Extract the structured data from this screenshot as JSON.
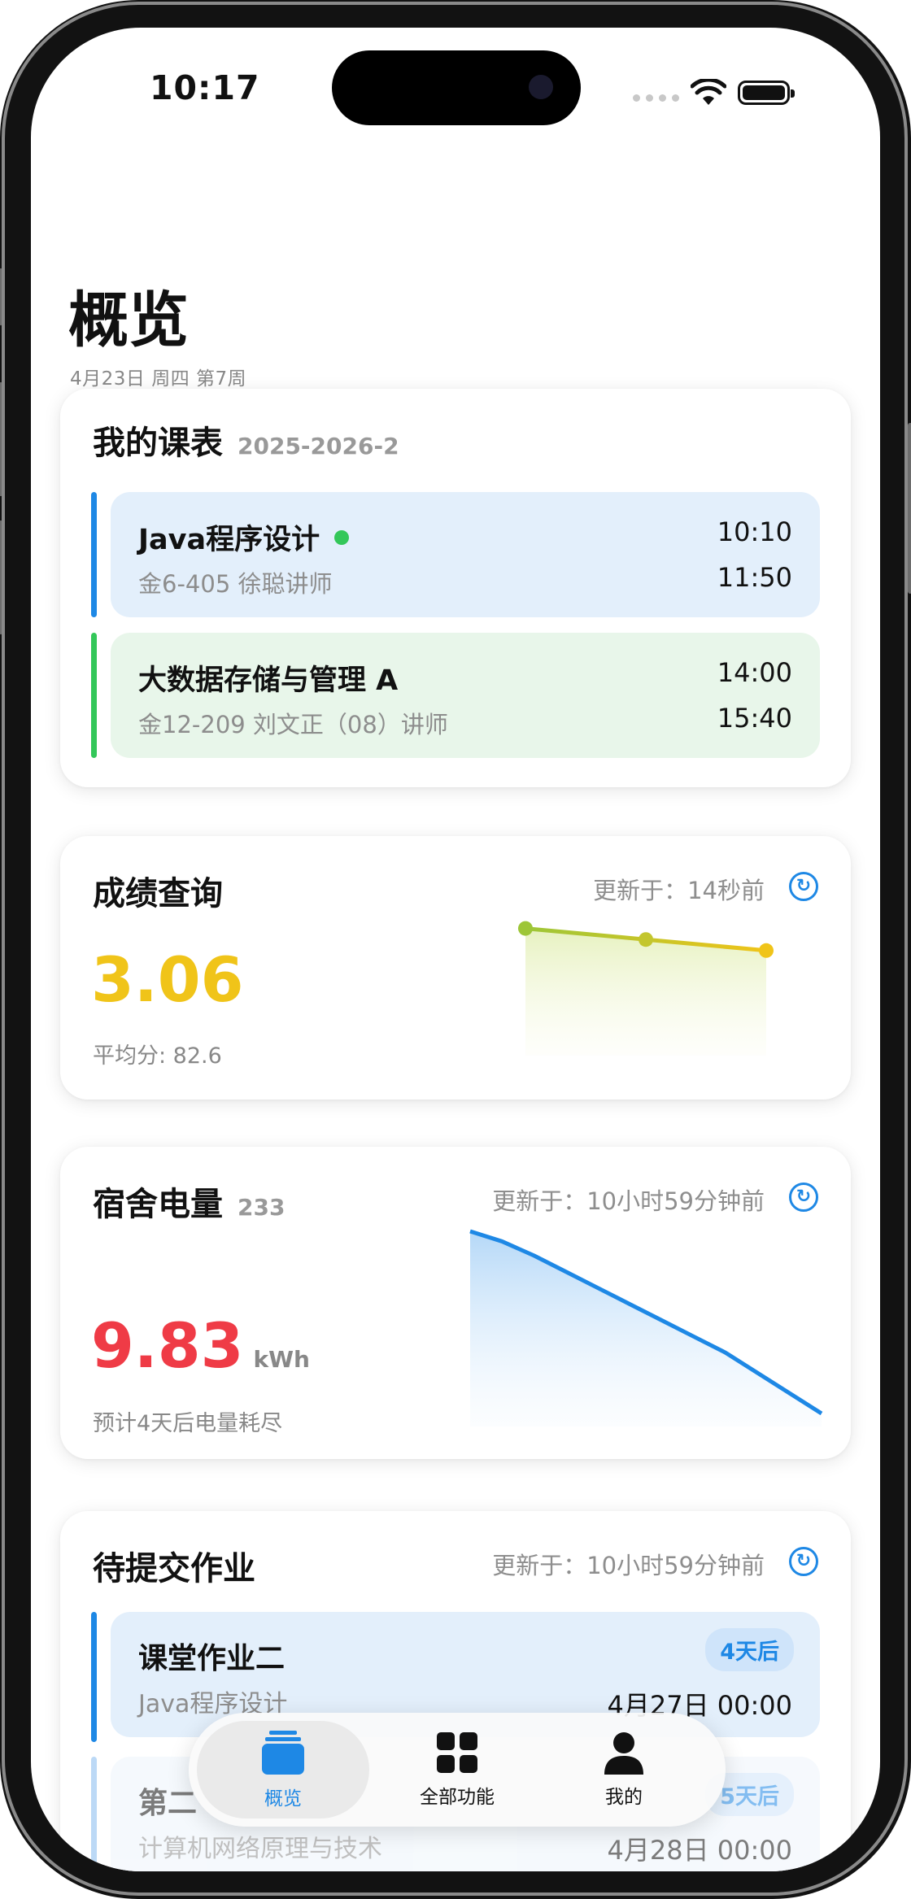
{
  "status_bar": {
    "time": "10:17"
  },
  "header": {
    "title": "概览",
    "subtitle": "4月23日 周四 第7周"
  },
  "schedule": {
    "title": "我的课表",
    "term": "2025-2026-2",
    "courses": [
      {
        "name": "Java程序设计",
        "meta": "金6-405  徐聪讲师",
        "start": "10:10",
        "end": "11:50",
        "color": "#1e88e5",
        "bg": "#e3effb",
        "live": true
      },
      {
        "name": "大数据存储与管理 A",
        "meta": "金12-209  刘文正（08）讲师",
        "start": "14:00",
        "end": "15:40",
        "color": "#33c759",
        "bg": "#e8f6ea",
        "live": false
      }
    ]
  },
  "grades": {
    "title": "成绩查询",
    "updated": "更新于：14秒前",
    "gpa": "3.06",
    "average": "平均分: 82.6",
    "gpa_color": "#f0c419"
  },
  "electricity": {
    "title": "宿舍电量",
    "room": "233",
    "updated": "更新于：10小时59分钟前",
    "value": "9.83",
    "unit": "kWh",
    "note": "预计4天后电量耗尽",
    "value_color": "#ef3b46"
  },
  "homework": {
    "title": "待提交作业",
    "updated": "更新于：10小时59分钟前",
    "items": [
      {
        "name": "课堂作业二",
        "course": "Java程序设计",
        "badge": "4天后",
        "due": "4月27日 00:00"
      },
      {
        "name": "第二",
        "course": "计算机网络原理与技术",
        "badge": "5天后",
        "due": "4月28日 00:00"
      }
    ]
  },
  "tabbar": {
    "items": [
      {
        "label": "概览",
        "icon": "stack-icon",
        "active": true
      },
      {
        "label": "全部功能",
        "icon": "grid-icon",
        "active": false
      },
      {
        "label": "我的",
        "icon": "person-icon",
        "active": false
      }
    ]
  },
  "chart_data": [
    {
      "type": "line",
      "chart": "grades-trend",
      "values": [
        3.12,
        3.09,
        3.06
      ],
      "point_colors": [
        "#9dc638",
        "#c3c62e",
        "#f0c419"
      ]
    },
    {
      "type": "area",
      "chart": "electricity-trend",
      "values": [
        100,
        95,
        88,
        80,
        72,
        64,
        56,
        48,
        40,
        30,
        20,
        10
      ]
    }
  ]
}
